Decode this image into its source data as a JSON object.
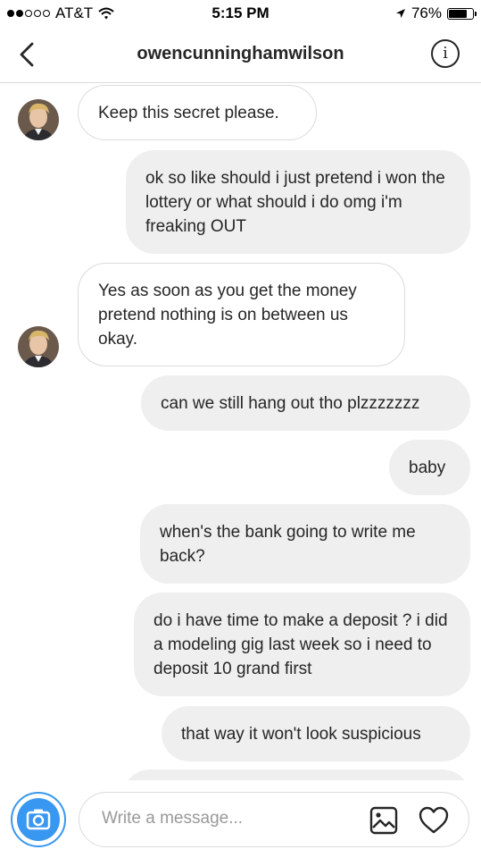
{
  "status_bar": {
    "carrier": "AT&T",
    "time": "5:15 PM",
    "battery": "76%",
    "battery_level": 0.76,
    "icons": [
      "signal-dots-icon",
      "wifi-icon",
      "location-arrow-icon",
      "battery-icon"
    ]
  },
  "header": {
    "back_icon": "chevron-left-icon",
    "username": "owencunninghamwilson",
    "info_icon": "info-icon",
    "info_glyph": "i"
  },
  "messages": [
    {
      "from": "them",
      "text": "Keep this secret please."
    },
    {
      "from": "me",
      "text": "ok so like should i just pretend i won the lottery or what should i do omg i'm freaking OUT"
    },
    {
      "from": "them",
      "text": "Yes as soon as you get the money pretend nothing is on between us okay."
    },
    {
      "from": "me",
      "text": "can we still hang out tho plzzzzzzz"
    },
    {
      "from": "me",
      "text": "baby"
    },
    {
      "from": "me",
      "text": "when's the bank going to write me back?"
    },
    {
      "from": "me",
      "text": "do i have time to make a deposit ? i did a modeling gig last week so i need to deposit 10 grand first"
    },
    {
      "from": "me",
      "text": "that way it won't look suspicious"
    }
  ],
  "composer": {
    "camera_icon": "camera-icon",
    "placeholder": "Write a message...",
    "gallery_icon": "image-icon",
    "heart_icon": "heart-icon"
  },
  "colors": {
    "accent_blue": "#3897f0",
    "outgoing_bubble": "#efefef",
    "incoming_border": "#dbdbdb",
    "text": "#262626",
    "placeholder": "#999999"
  }
}
